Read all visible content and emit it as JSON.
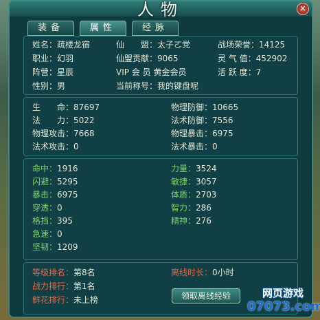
{
  "window": {
    "title": "人物",
    "close_label": "×"
  },
  "tabs": [
    {
      "label": "装备"
    },
    {
      "label": "属性"
    },
    {
      "label": "经脉"
    }
  ],
  "info": {
    "name_l": "姓名：",
    "name_v": "疏楼龙宿",
    "clan_l": "仙　　盟：",
    "clan_v": "太子ㄛ党",
    "honor_l": "战场荣誉：",
    "honor_v": "14125",
    "job_l": "职业：",
    "job_v": "幻羽",
    "contrib_l": "仙盟贡献：",
    "contrib_v": "9065",
    "aura_l": "灵 气 值：",
    "aura_v": "452902",
    "camp_l": "阵营：",
    "camp_v": "星辰",
    "vip_l": "VIP 会 员",
    "vip_v": "黄金会员",
    "active_l": "活 跃 度：",
    "active_v": "7",
    "gender_l": "性别：",
    "gender_v": "男",
    "titlecur_l": "当前称号：",
    "titlecur_v": "我的键盘呢"
  },
  "base": {
    "hp_l": "生　　命：",
    "hp_v": "87697",
    "pdef_l": "物理防御：",
    "pdef_v": "10665",
    "mp_l": "法　　力：",
    "mp_v": "5022",
    "mdef_l": "法术防御：",
    "mdef_v": "7556",
    "patk_l": "物理攻击：",
    "patk_v": "7668",
    "pcrit_l": "物理暴击：",
    "pcrit_v": "6975",
    "matk_l": "法术攻击：",
    "matk_v": "0",
    "mcrit_l": "法术暴击：",
    "mcrit_v": "0"
  },
  "adv": {
    "hit_l": "命中：",
    "hit_v": "1916",
    "str_l": "力量：",
    "str_v": "3524",
    "dodge_l": "闪避：",
    "dodge_v": "5295",
    "agi_l": "敏捷：",
    "agi_v": "3057",
    "crit_l": "暴击：",
    "crit_v": "6975",
    "con_l": "体质：",
    "con_v": "2703",
    "pen_l": "穿透：",
    "pen_v": "0",
    "int_l": "智力：",
    "int_v": "286",
    "block_l": "格挡：",
    "block_v": "395",
    "spi_l": "精神：",
    "spi_v": "276",
    "haste_l": "急速：",
    "haste_v": "0",
    "tough_l": "坚韧：",
    "tough_v": "1209"
  },
  "rank": {
    "level_l": "等级排名：",
    "level_v": "第8名",
    "offline_l": "离线时长：",
    "offline_v": "0小时",
    "power_l": "战力排行：",
    "power_v": "第1名",
    "flower_l": "鲜花排行：",
    "flower_v": "未上榜",
    "claim_label": "领取离线经验"
  },
  "logo": {
    "top": "网页游戏",
    "bottom": "07073.com"
  }
}
